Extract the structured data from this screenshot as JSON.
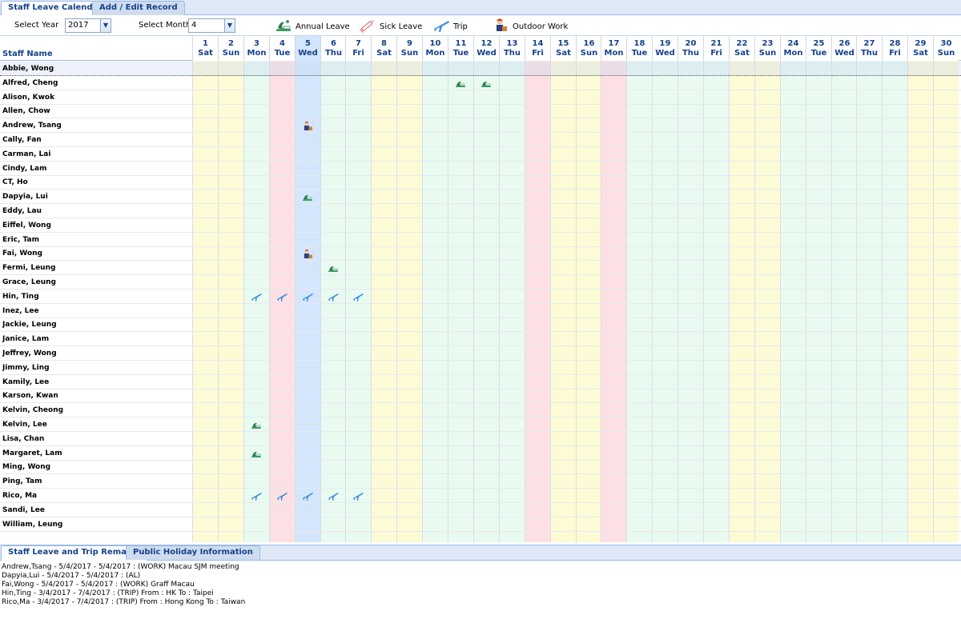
{
  "tabs": [
    {
      "label": "Staff Leave Calendar",
      "active": true
    },
    {
      "label": "Add / Edit Record",
      "active": false
    }
  ],
  "toolbar": {
    "year_label": "Select Year",
    "year_value": "2017",
    "month_label": "Select Month",
    "month_value": "4",
    "legend": [
      {
        "icon": "annual-leave-icon",
        "label": "Annual Leave"
      },
      {
        "icon": "sick-leave-icon",
        "label": "Sick Leave"
      },
      {
        "icon": "trip-icon",
        "label": "Trip"
      },
      {
        "icon": "outdoor-work-icon",
        "label": "Outdoor Work"
      }
    ]
  },
  "colors": {
    "weekend": "#fdfbd5",
    "holiday": "#fde0e3",
    "weekday": "#e9fbf1",
    "today": "#d3e6fb",
    "header_text": "#15428b"
  },
  "grid": {
    "name_header": "Staff Name",
    "days": [
      {
        "num": "1",
        "dow": "Sat",
        "kind": "weekend"
      },
      {
        "num": "2",
        "dow": "Sun",
        "kind": "weekend"
      },
      {
        "num": "3",
        "dow": "Mon",
        "kind": "weekday"
      },
      {
        "num": "4",
        "dow": "Tue",
        "kind": "holiday"
      },
      {
        "num": "5",
        "dow": "Wed",
        "kind": "today"
      },
      {
        "num": "6",
        "dow": "Thu",
        "kind": "weekday"
      },
      {
        "num": "7",
        "dow": "Fri",
        "kind": "weekday"
      },
      {
        "num": "8",
        "dow": "Sat",
        "kind": "weekend"
      },
      {
        "num": "9",
        "dow": "Sun",
        "kind": "weekend"
      },
      {
        "num": "10",
        "dow": "Mon",
        "kind": "weekday"
      },
      {
        "num": "11",
        "dow": "Tue",
        "kind": "weekday"
      },
      {
        "num": "12",
        "dow": "Wed",
        "kind": "weekday"
      },
      {
        "num": "13",
        "dow": "Thu",
        "kind": "weekday"
      },
      {
        "num": "14",
        "dow": "Fri",
        "kind": "holiday"
      },
      {
        "num": "15",
        "dow": "Sat",
        "kind": "weekend"
      },
      {
        "num": "16",
        "dow": "Sun",
        "kind": "weekend"
      },
      {
        "num": "17",
        "dow": "Mon",
        "kind": "holiday"
      },
      {
        "num": "18",
        "dow": "Tue",
        "kind": "weekday"
      },
      {
        "num": "19",
        "dow": "Wed",
        "kind": "weekday"
      },
      {
        "num": "20",
        "dow": "Thu",
        "kind": "weekday"
      },
      {
        "num": "21",
        "dow": "Fri",
        "kind": "weekday"
      },
      {
        "num": "22",
        "dow": "Sat",
        "kind": "weekend"
      },
      {
        "num": "23",
        "dow": "Sun",
        "kind": "weekend"
      },
      {
        "num": "24",
        "dow": "Mon",
        "kind": "weekday"
      },
      {
        "num": "25",
        "dow": "Tue",
        "kind": "weekday"
      },
      {
        "num": "26",
        "dow": "Wed",
        "kind": "weekday"
      },
      {
        "num": "27",
        "dow": "Thu",
        "kind": "weekday"
      },
      {
        "num": "28",
        "dow": "Fri",
        "kind": "weekday"
      },
      {
        "num": "29",
        "dow": "Sat",
        "kind": "weekend"
      },
      {
        "num": "30",
        "dow": "Sun",
        "kind": "weekend"
      }
    ],
    "staff": [
      {
        "name": "Abbie, Wong",
        "selected": true,
        "marks": []
      },
      {
        "name": "Alfred, Cheng",
        "marks": [
          {
            "day": 11,
            "type": "annual"
          },
          {
            "day": 12,
            "type": "annual"
          }
        ]
      },
      {
        "name": "Alison, Kwok",
        "marks": []
      },
      {
        "name": "Allen, Chow",
        "marks": []
      },
      {
        "name": "Andrew, Tsang",
        "marks": [
          {
            "day": 5,
            "type": "work"
          }
        ]
      },
      {
        "name": "Cally, Fan",
        "marks": []
      },
      {
        "name": "Carman, Lai",
        "marks": []
      },
      {
        "name": "Cindy, Lam",
        "marks": []
      },
      {
        "name": "CT, Ho",
        "marks": []
      },
      {
        "name": "Dapyia, Lui",
        "marks": [
          {
            "day": 5,
            "type": "annual"
          }
        ]
      },
      {
        "name": "Eddy, Lau",
        "marks": []
      },
      {
        "name": "Eiffel, Wong",
        "marks": []
      },
      {
        "name": "Eric, Tam",
        "marks": []
      },
      {
        "name": "Fai, Wong",
        "marks": [
          {
            "day": 5,
            "type": "work"
          }
        ]
      },
      {
        "name": "Fermi, Leung",
        "marks": [
          {
            "day": 6,
            "type": "annual"
          }
        ]
      },
      {
        "name": "Grace, Leung",
        "marks": []
      },
      {
        "name": "Hin, Ting",
        "marks": [
          {
            "day": 3,
            "type": "trip"
          },
          {
            "day": 4,
            "type": "trip"
          },
          {
            "day": 5,
            "type": "trip"
          },
          {
            "day": 6,
            "type": "trip"
          },
          {
            "day": 7,
            "type": "trip"
          }
        ]
      },
      {
        "name": "Inez, Lee",
        "marks": []
      },
      {
        "name": "Jackie, Leung",
        "marks": []
      },
      {
        "name": "Janice, Lam",
        "marks": []
      },
      {
        "name": "Jeffrey, Wong",
        "marks": []
      },
      {
        "name": "Jimmy, Ling",
        "marks": []
      },
      {
        "name": "Kamily, Lee",
        "marks": []
      },
      {
        "name": "Karson, Kwan",
        "marks": []
      },
      {
        "name": "Kelvin, Cheong",
        "marks": []
      },
      {
        "name": "Kelvin, Lee",
        "marks": [
          {
            "day": 3,
            "type": "annual"
          }
        ]
      },
      {
        "name": "Lisa, Chan",
        "marks": []
      },
      {
        "name": "Margaret, Lam",
        "marks": [
          {
            "day": 3,
            "type": "annual"
          }
        ]
      },
      {
        "name": "Ming, Wong",
        "marks": []
      },
      {
        "name": "Ping, Tam",
        "marks": []
      },
      {
        "name": "Rico, Ma",
        "marks": [
          {
            "day": 3,
            "type": "trip"
          },
          {
            "day": 4,
            "type": "trip"
          },
          {
            "day": 5,
            "type": "trip"
          },
          {
            "day": 6,
            "type": "trip"
          },
          {
            "day": 7,
            "type": "trip"
          }
        ]
      },
      {
        "name": "Sandi, Lee",
        "marks": []
      },
      {
        "name": "William, Leung",
        "marks": []
      }
    ]
  },
  "bottom_tabs": [
    {
      "label": "Staff Leave and Trip Remarks",
      "active": true
    },
    {
      "label": "Public Holiday Information",
      "active": false
    }
  ],
  "remarks": [
    "Andrew,Tsang - 5/4/2017 - 5/4/2017 : (WORK) Macau SJM meeting",
    "Dapyia,Lui - 5/4/2017 - 5/4/2017 : (AL)",
    "Fai,Wong - 5/4/2017 - 5/4/2017 : (WORK) Graff Macau",
    "Hin,Ting - 3/4/2017 - 7/4/2017 : (TRIP) From : HK To : Taipei",
    "Rico,Ma - 3/4/2017 - 7/4/2017 : (TRIP) From : Hong Kong To : Taiwan"
  ]
}
